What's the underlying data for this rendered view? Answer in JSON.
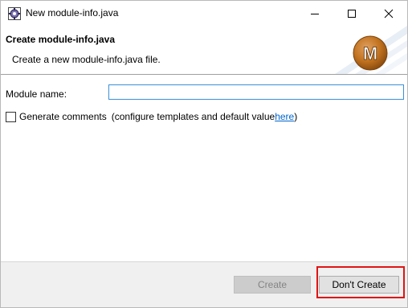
{
  "window": {
    "title": "New module-info.java",
    "icons": {
      "app": "eclipse-gear-icon",
      "minimize": "minimize-icon",
      "maximize": "maximize-icon",
      "close": "close-icon"
    }
  },
  "banner": {
    "title": "Create module-info.java",
    "description": "Create a new module-info.java file.",
    "logo_letter": "M",
    "logo_icon": "module-logo-icon"
  },
  "form": {
    "module_name_label": "Module name:",
    "module_name_value": "",
    "generate_comments": {
      "checked": false,
      "label": "Generate comments",
      "hint_prefix": "(configure templates and default value ",
      "link_text": "here",
      "hint_suffix": ")"
    }
  },
  "buttons": {
    "create": {
      "label": "Create",
      "enabled": false
    },
    "dont_create": {
      "label": "Don't Create",
      "enabled": true,
      "highlighted": true
    }
  },
  "colors": {
    "accent_input_border": "#3c8fd8",
    "link": "#0066cc",
    "highlight": "#e11414",
    "logo": "#c2731f"
  }
}
